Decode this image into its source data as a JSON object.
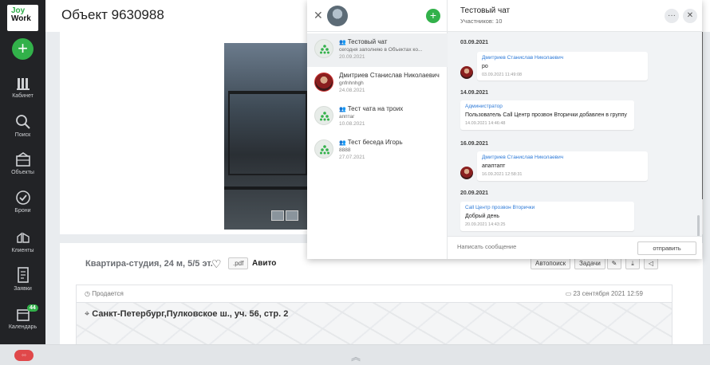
{
  "app": {
    "logo_line1": "Joy",
    "logo_line2": "Work",
    "accent": "#32b14a"
  },
  "sidebar": {
    "add_symbol": "+",
    "items": [
      {
        "label": "Кабинет",
        "icon": "cabinet-icon"
      },
      {
        "label": "Поиск",
        "icon": "search-icon"
      },
      {
        "label": "Объекты",
        "icon": "objects-icon"
      },
      {
        "label": "Брони",
        "icon": "booking-icon"
      },
      {
        "label": "Клиенты",
        "icon": "clients-icon"
      },
      {
        "label": "Заявки",
        "icon": "requests-icon"
      },
      {
        "label": "Календарь",
        "icon": "calendar-icon"
      }
    ],
    "calendar_badge": "44"
  },
  "header": {
    "title": "Объект 9630988"
  },
  "listing": {
    "title": "Квартира-студия, 24 м, 5/5 эт.",
    "pdf_label": ".pdf",
    "source": "Авито",
    "buttons": {
      "autosearch": "Автопоиск",
      "tasks": "Задачи"
    },
    "status": "Продается",
    "date": "23 сентября 2021  12:59",
    "address": "Санкт-Петербург,Пулковское ш., уч. 56, стр. 2"
  },
  "chat_list": {
    "items": [
      {
        "title": "Тестовый чат",
        "subtitle": "сегодня заполняю в Объектах ко...",
        "date": "20.09.2021",
        "type": "group"
      },
      {
        "title": "Дмитриев Станислав Николаевич",
        "subtitle": "gnfnhnhgh",
        "date": "24.08.2021",
        "type": "person"
      },
      {
        "title": "Тест чата на троих",
        "subtitle": "апптаг",
        "date": "10.08.2021",
        "type": "group"
      },
      {
        "title": "Тест беседа Игорь",
        "subtitle": "8888",
        "date": "27.07.2021",
        "type": "group"
      }
    ]
  },
  "chat": {
    "title": "Тестовый чат",
    "members": "Участников: 10",
    "messages": [
      {
        "date": "03.09.2021",
        "author": "Дмитриев Станислав Николаевич",
        "text": "ро",
        "time": "03.09.2021 11:49:08"
      },
      {
        "date": "14.09.2021",
        "author": "Администратор",
        "text": "Пользователь Call Центр прозвон Вторички добавлен в группу",
        "time": "14.09.2021 14:46:48"
      },
      {
        "date": "16.09.2021",
        "author": "Дмитриев Станислав Николаевич",
        "text": "апаптапт",
        "time": "16.09.2021 12:58:31"
      },
      {
        "date": "20.09.2021",
        "author": "Call Центр прозвон Вторички",
        "text": "Добрый день",
        "time": "20.09.2021 14:43:25"
      }
    ],
    "composer_placeholder": "Написать сообщение",
    "send_label": "отправить"
  }
}
